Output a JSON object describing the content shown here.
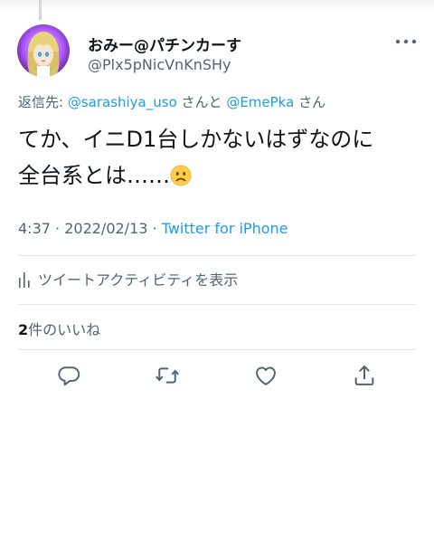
{
  "tweet": {
    "author": {
      "display_name": "おみー@パチンカーす",
      "handle": "@Plx5pNicVnKnSHy"
    },
    "reply_to": {
      "prefix": "返信先: ",
      "mention1": "@sarashiya_uso",
      "connector": " さんと ",
      "mention2": "@EmePka",
      "suffix": " さん"
    },
    "text": {
      "line1": "てか、イニD1台しかないはずなのに",
      "line2": "全台系とは……",
      "emoji": "worried-face"
    },
    "meta": {
      "time": "4:37",
      "separator1": " · ",
      "date": "2022/02/13",
      "separator2": " · ",
      "source": "Twitter for iPhone"
    },
    "analytics_label": "ツイートアクティビティを表示",
    "likes": {
      "count": "2",
      "label": "件のいいね"
    }
  },
  "icons": {
    "more": "more-horizontal-icon",
    "analytics": "bar-chart-icon",
    "reply": "reply-icon",
    "retweet": "retweet-icon",
    "like": "heart-icon",
    "share": "share-icon"
  },
  "colors": {
    "link": "#1d9bf0",
    "secondary_text": "#536471",
    "primary_text": "#0f1419",
    "divider": "#e1e8ed"
  }
}
